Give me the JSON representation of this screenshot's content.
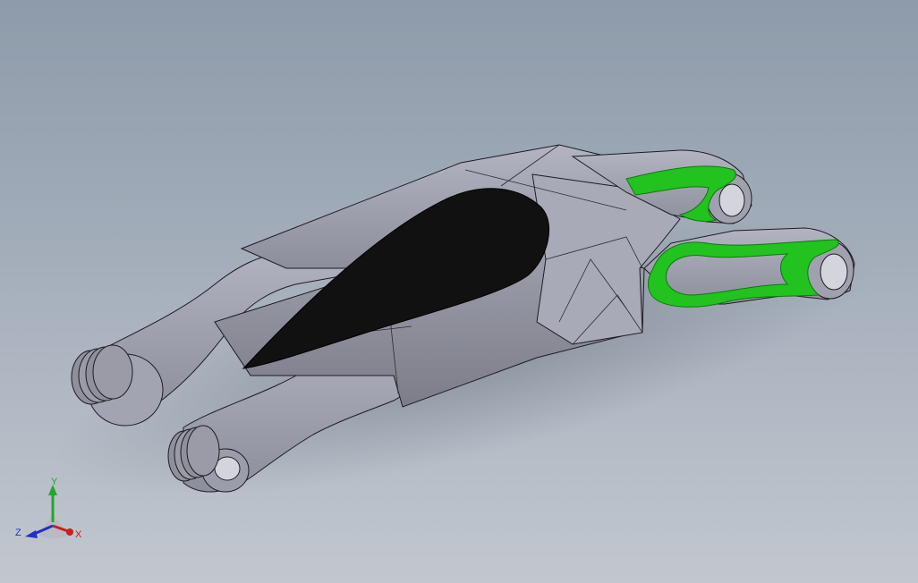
{
  "viewport": {
    "background_top": "#8e9baa",
    "background_bottom": "#c2c7cf"
  },
  "model": {
    "body_color": "#a6a7b4",
    "canopy_color": "#111111",
    "highlight_color": "#22c21f",
    "edge_color": "#1c1c22"
  },
  "triad": {
    "y_label": "Y",
    "z_label": "Z",
    "x_label": "X",
    "y_color": "#1fa82c",
    "z_color": "#2030c8",
    "x_color": "#c8201e"
  }
}
